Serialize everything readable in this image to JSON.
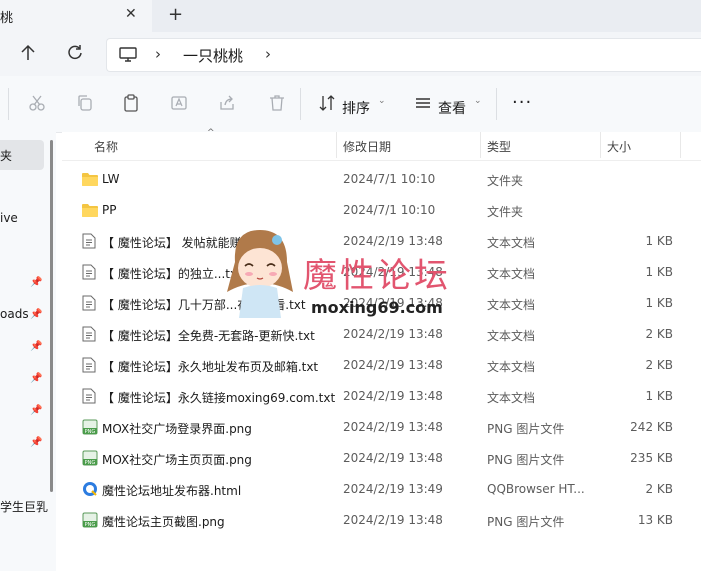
{
  "tab": {
    "title": "桃",
    "close_glyph": "✕",
    "add_glyph": "+"
  },
  "address": {
    "chevron": "›",
    "crumb": "一只桃桃",
    "chevron2": "›"
  },
  "toolbar": {
    "sort_label": "排序",
    "view_label": "查看",
    "more_label": "···",
    "caret": "⌄"
  },
  "nav": {
    "items": [
      {
        "label": "夹",
        "pinned": false
      },
      {
        "label": "ive",
        "pinned": false
      },
      {
        "label": "oads",
        "pinned": true
      },
      {
        "label": "学生巨乳",
        "pinned": false
      }
    ],
    "pin_glyph": "📌"
  },
  "columns": {
    "name": "名称",
    "date": "修改日期",
    "type": "类型",
    "size": "大小",
    "sort_caret": "^"
  },
  "files": [
    {
      "name": "LW",
      "date": "2024/7/1 10:10",
      "type": "文件夹",
      "size": "",
      "icon": "folder-icon"
    },
    {
      "name": "PP",
      "date": "2024/7/1 10:10",
      "type": "文件夹",
      "size": "",
      "icon": "folder-icon"
    },
    {
      "name": "【 魔性论坛】 发帖就能赚钱.txt",
      "date": "2024/2/19 13:48",
      "type": "文本文档",
      "size": "1 KB",
      "icon": "text-file-icon"
    },
    {
      "name": "【 魔性论坛】的独立...txt",
      "date": "2024/2/19 13:48",
      "type": "文本文档",
      "size": "1 KB",
      "icon": "text-file-icon"
    },
    {
      "name": "【 魔性论坛】几十万部...在线观看.txt",
      "date": "2024/2/19 13:48",
      "type": "文本文档",
      "size": "1 KB",
      "icon": "text-file-icon"
    },
    {
      "name": "【 魔性论坛】全免费-无套路-更新快.txt",
      "date": "2024/2/19 13:48",
      "type": "文本文档",
      "size": "2 KB",
      "icon": "text-file-icon"
    },
    {
      "name": "【 魔性论坛】永久地址发布页及邮箱.txt",
      "date": "2024/2/19 13:48",
      "type": "文本文档",
      "size": "2 KB",
      "icon": "text-file-icon"
    },
    {
      "name": "【 魔性论坛】永久链接moxing69.com.txt",
      "date": "2024/2/19 13:48",
      "type": "文本文档",
      "size": "1 KB",
      "icon": "text-file-icon"
    },
    {
      "name": "MOX社交广场登录界面.png",
      "date": "2024/2/19 13:48",
      "type": "PNG 图片文件",
      "size": "242 KB",
      "icon": "png-file-icon"
    },
    {
      "name": "MOX社交广场主页页面.png",
      "date": "2024/2/19 13:48",
      "type": "PNG 图片文件",
      "size": "235 KB",
      "icon": "png-file-icon"
    },
    {
      "name": "魔性论坛地址发布器.html",
      "date": "2024/2/19 13:49",
      "type": "QQBrowser HT...",
      "size": "2 KB",
      "icon": "browser-file-icon"
    },
    {
      "name": "魔性论坛主页截图.png",
      "date": "2024/2/19 13:48",
      "type": "PNG 图片文件",
      "size": "13 KB",
      "icon": "png-file-icon"
    }
  ],
  "watermark": {
    "text": "魔性论坛",
    "url": "moxing69.com"
  },
  "colors": {
    "folder": "#f4c542",
    "accent": "#0b5cad",
    "watermark": "#e2556f"
  }
}
